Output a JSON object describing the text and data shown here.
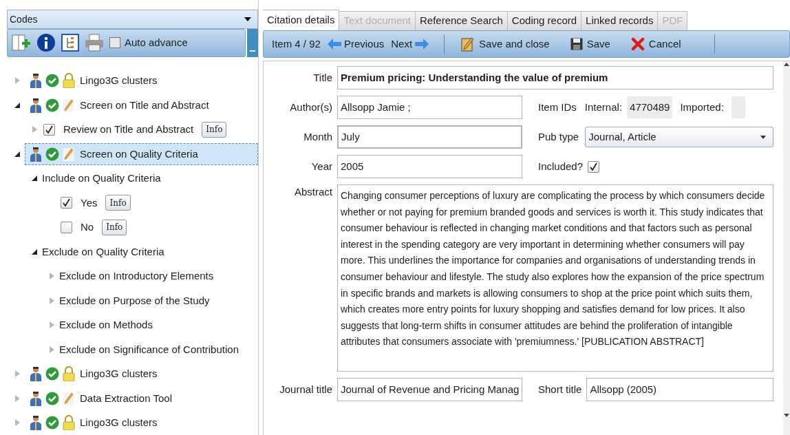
{
  "codes_panel": {
    "title": "Codes",
    "toolbar": {
      "auto_advance": {
        "label": "Auto advance",
        "checked": false
      }
    },
    "tree": [
      {
        "kind": "code_set",
        "label": "Lingo3G clusters",
        "locked": true,
        "expanded": false
      },
      {
        "kind": "code_set",
        "label": "Screen on Title and Abstract",
        "locked": false,
        "expanded": true,
        "children": [
          {
            "kind": "attribute",
            "label": "Review on Title and Abstract",
            "checked": true,
            "info": "Info",
            "expanded": false
          }
        ]
      },
      {
        "kind": "code_set",
        "label": "Screen on Quality Criteria",
        "locked": false,
        "expanded": true,
        "selected": true,
        "children": [
          {
            "kind": "plain",
            "label": "Include on Quality Criteria",
            "expanded": true,
            "children": [
              {
                "kind": "attribute",
                "label": "Yes",
                "checked": true,
                "info": "Info"
              },
              {
                "kind": "attribute",
                "label": "No",
                "checked": false,
                "info": "Info"
              }
            ]
          },
          {
            "kind": "plain",
            "label": "Exclude on Quality Criteria",
            "expanded": true,
            "children": [
              {
                "kind": "plain",
                "label": "Exclude on Introductory Elements",
                "expanded": false
              },
              {
                "kind": "plain",
                "label": "Exclude on Purpose of the Study",
                "expanded": false
              },
              {
                "kind": "plain",
                "label": "Exclude on Methods",
                "expanded": false
              },
              {
                "kind": "plain",
                "label": "Exclude on Significance of Contribution",
                "expanded": false
              }
            ]
          }
        ]
      },
      {
        "kind": "code_set",
        "label": "Lingo3G clusters",
        "locked": true,
        "expanded": false
      },
      {
        "kind": "code_set",
        "label": "Data Extraction Tool",
        "locked": false,
        "expanded": false
      },
      {
        "kind": "code_set",
        "label": "Lingo3G clusters",
        "locked": true,
        "expanded": false
      }
    ]
  },
  "tabs": [
    {
      "label": "Citation details",
      "selected": true,
      "disabled": false
    },
    {
      "label": "Text document",
      "selected": false,
      "disabled": true
    },
    {
      "label": "Reference Search",
      "selected": false,
      "disabled": false
    },
    {
      "label": "Coding record",
      "selected": false,
      "disabled": false
    },
    {
      "label": "Linked records",
      "selected": false,
      "disabled": false
    },
    {
      "label": "PDF",
      "selected": false,
      "disabled": true
    }
  ],
  "record_toolbar": {
    "item_counter": "Item 4 / 92",
    "previous": "Previous",
    "next": "Next",
    "save_and_close": "Save and close",
    "save": "Save",
    "cancel": "Cancel"
  },
  "form": {
    "title": {
      "label": "Title",
      "value": "Premium pricing: Understanding the value of premium"
    },
    "authors": {
      "label": "Author(s)",
      "value": "Allsopp Jamie ;"
    },
    "month": {
      "label": "Month",
      "value": "July"
    },
    "year": {
      "label": "Year",
      "value": "2005"
    },
    "item_ids": {
      "label": "Item IDs",
      "internal_label": "Internal:",
      "internal": "4770489",
      "imported_label": "Imported:"
    },
    "pub_type": {
      "label": "Pub type",
      "value": "Journal, Article"
    },
    "included": {
      "label": "Included?",
      "checked": true
    },
    "abstract": {
      "label": "Abstract",
      "value": "Changing consumer perceptions of luxury are complicating the process by which consumers decide whether or not paying for premium branded goods and services is worth it. This study indicates that consumer behaviour is reflected in changing market conditions and that factors such as personal interest in the spending category are very important in determining whether consumers will pay more. This underlines the importance for companies and organisations of understanding trends in consumer behaviour and lifestyle. The study also explores how the expansion of the price spectrum in specific brands and markets is allowing consumers to shop at the price point which suits them, which creates more entry points for luxury shopping and satisfies demand for low prices. It also suggests that long-term shifts in consumer attitudes are behind the proliferation of intangible attributes that consumers associate with 'premiumness.' [PUBLICATION ABSTRACT]"
    },
    "journal_title": {
      "label": "Journal title",
      "value": "Journal of Revenue and Pricing Manag"
    },
    "short_title": {
      "label": "Short title",
      "value": "Allsopp (2005)"
    }
  }
}
